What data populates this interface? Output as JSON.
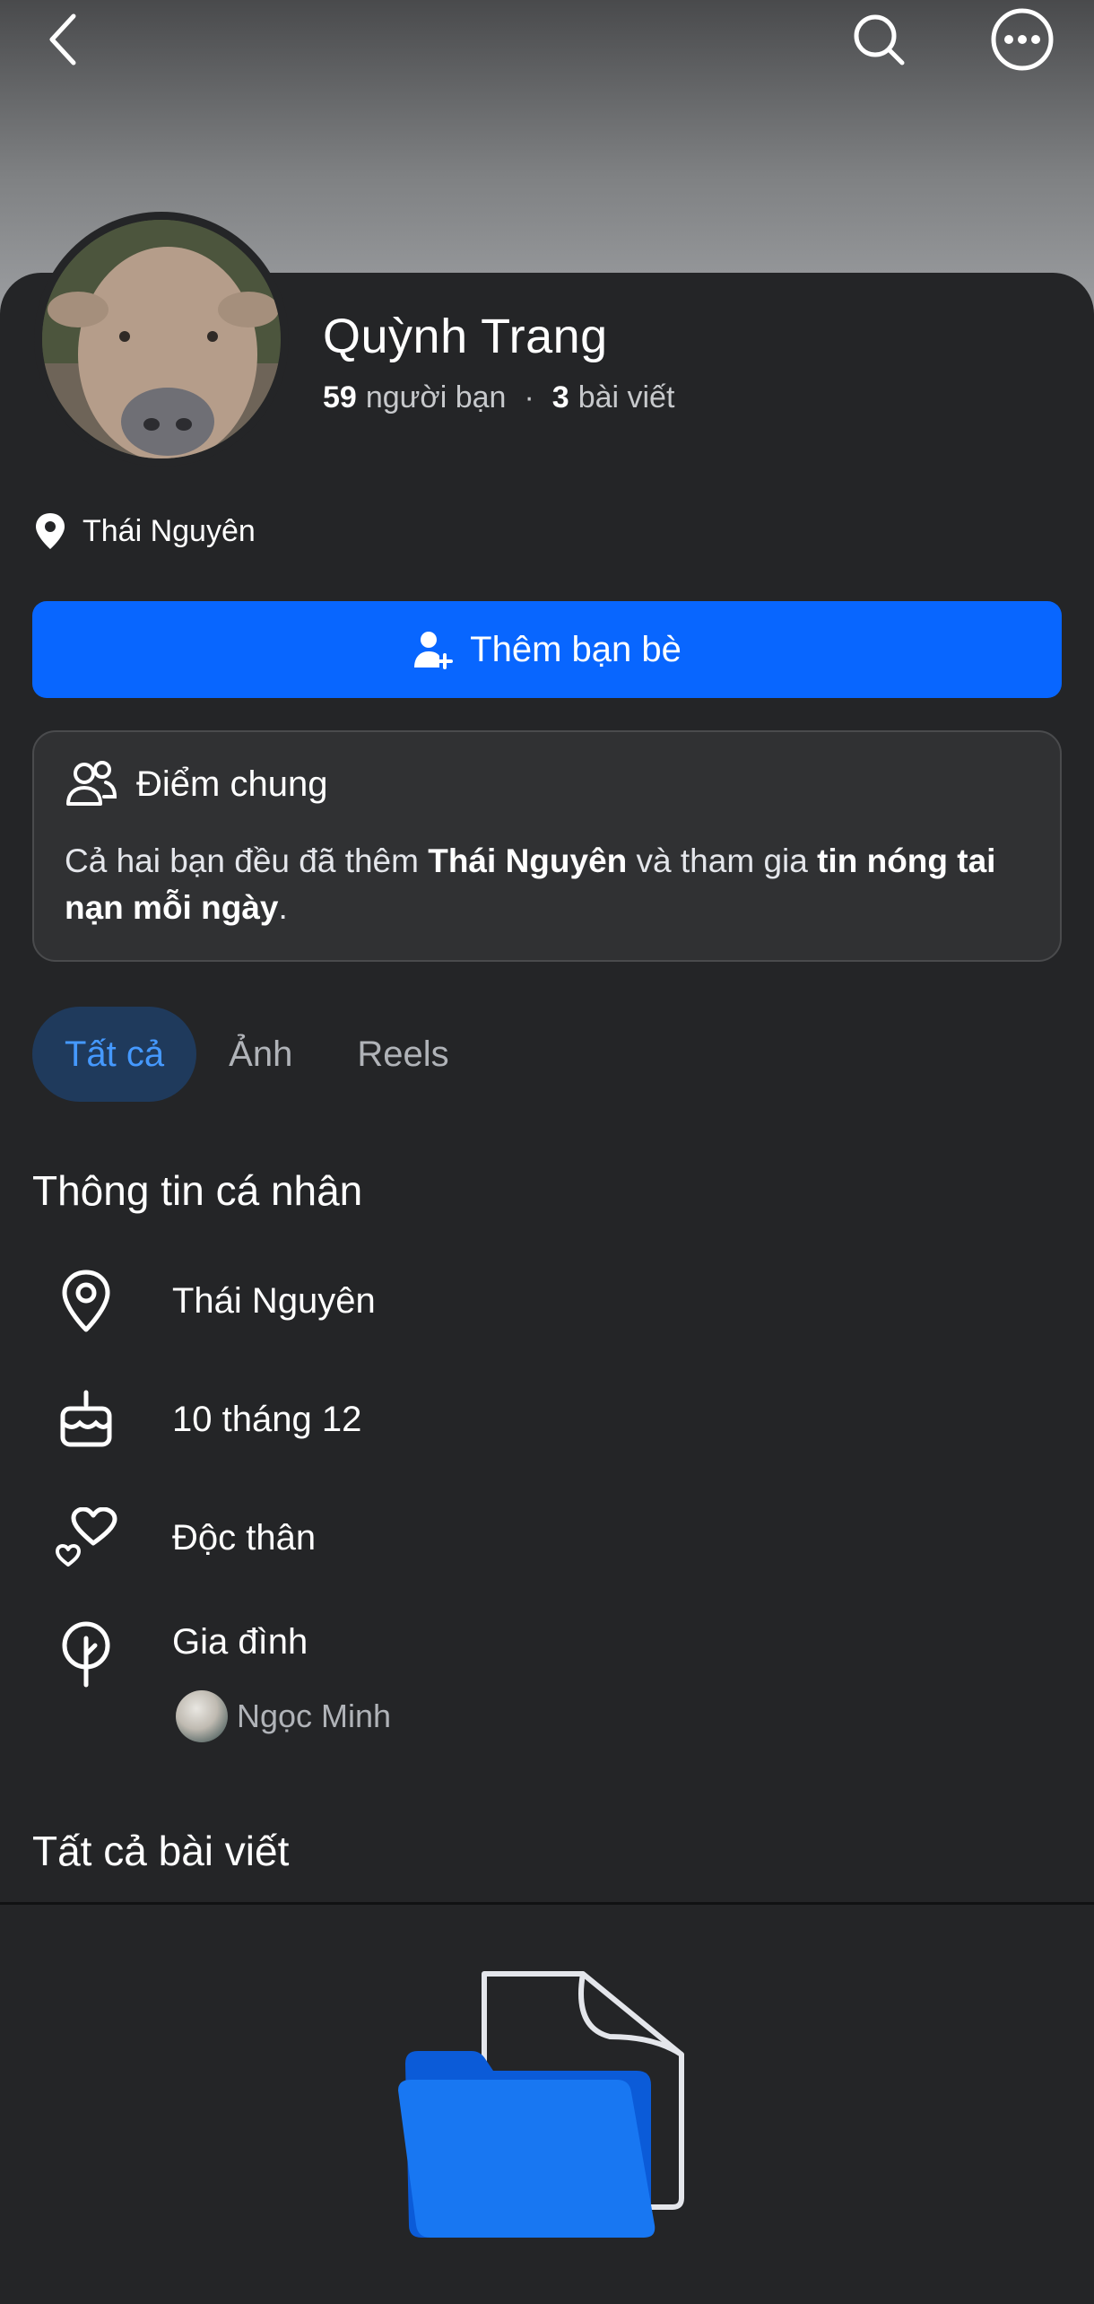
{
  "header": {
    "back_icon": "chevron-left-icon",
    "search_icon": "search-icon",
    "more_icon": "more-icon"
  },
  "profile": {
    "name": "Quỳnh Trang",
    "friends_count": "59",
    "friends_label": "người bạn",
    "separator": "·",
    "posts_count": "3",
    "posts_label": "bài viết",
    "location": "Thái Nguyên"
  },
  "actions": {
    "add_friend_label": "Thêm bạn bè"
  },
  "common": {
    "title": "Điểm chung",
    "text_part1": "Cả hai bạn đều đã thêm ",
    "text_bold1": "Thái Nguyên",
    "text_part2": " và tham gia ",
    "text_bold2": "tin nóng tai nạn mỗi ngày",
    "text_part3": "."
  },
  "tabs": [
    {
      "label": "Tất cả",
      "active": true
    },
    {
      "label": "Ảnh",
      "active": false
    },
    {
      "label": "Reels",
      "active": false
    }
  ],
  "personal_info": {
    "title": "Thông tin cá nhân",
    "location": "Thái Nguyên",
    "birthday": "10 tháng 12",
    "relationship": "Độc thân",
    "family_label": "Gia đình",
    "family_member": "Ngọc Minh"
  },
  "posts": {
    "title": "Tất cả bài viết"
  },
  "colors": {
    "accent": "#0866ff",
    "background": "#242527",
    "tab_active_bg": "#1f3a5c",
    "tab_active_text": "#4599ff"
  }
}
